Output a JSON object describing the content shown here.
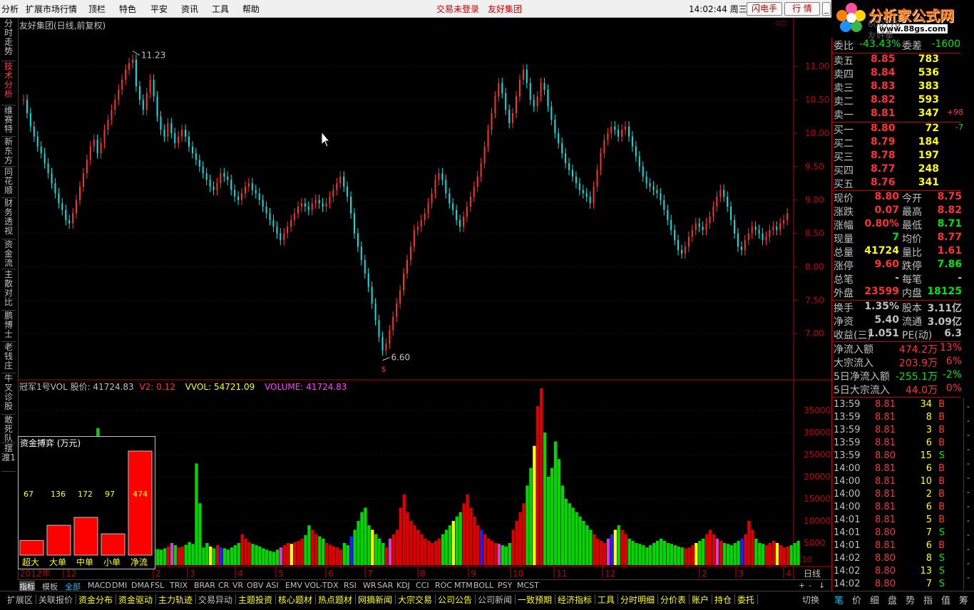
{
  "menu": [
    "分析",
    "扩展市场行情",
    "顶栏",
    "特色",
    "平安",
    "资讯",
    "工具",
    "帮助"
  ],
  "menu_alert": [
    "交易未登录",
    "友好集团"
  ],
  "clock": "14:02:44 周三",
  "menu_buttons": [
    "闪电手",
    "行 情"
  ],
  "logo": {
    "text": "分析家公式网",
    "url": "www.88gs.com"
  },
  "left_tabs": [
    "分时走势",
    "技术分析",
    "维赛特",
    "新东方",
    "同花顺",
    "财务透视",
    "资金流",
    "主散对比",
    "鹏博士",
    "老钱庄",
    "牛叉诊股",
    "敢死队",
    "摆渡1"
  ],
  "chart_title": "友好集团(日线,前复权)",
  "chart_code": "600778 友好集团",
  "price_axis": [
    "11.00",
    "10.50",
    "10.00",
    "9.50",
    "9.00",
    "8.50",
    "8.00",
    "7.50",
    "7.00"
  ],
  "annotations": {
    "high": "11.23",
    "low": "6.60",
    "low_mark": "$"
  },
  "indicator_header": {
    "name": "冠军1号VOL  股价: 41724.83",
    "v2": "V2: 0.12",
    "vvol": "VVOL: 54721.09",
    "volume": "VOLUME: 41724.83"
  },
  "volume_axis": [
    "35000",
    "30000",
    "25000",
    "20000",
    "15000",
    "10000",
    "5000"
  ],
  "volume_scale": "X10",
  "time_axis": [
    "2012年",
    "12",
    "2",
    "3",
    "4",
    "5",
    "6",
    "7",
    "8",
    "9",
    "10",
    "11",
    "12",
    "2",
    "3",
    "4"
  ],
  "period_label": "日线",
  "money_box": {
    "title": "资金搏弈 (万元)",
    "labels": [
      "超大",
      "大单",
      "中单",
      "小单",
      "净流"
    ],
    "values": [
      67,
      136,
      172,
      97,
      474
    ]
  },
  "indicator_tabs": [
    "指标",
    "模板",
    "全部",
    "MACD",
    "DMI",
    "DMA",
    "FSL",
    "TRIX",
    "BRAR",
    "CR",
    "VR",
    "OBV",
    "ASI",
    "EMV",
    "VOL-TDX",
    "RSI",
    "WR",
    "SAR",
    "KDJ",
    "CCI",
    "ROC",
    "MTM",
    "BOLL",
    "PSY",
    "MCST"
  ],
  "bottom_tabs": [
    "扩展区",
    "关联报价",
    "资金分布",
    "资金驱动",
    "主力轨迹",
    "交易异动",
    "主题投资",
    "核心题材",
    "热点题材",
    "网摘新闻",
    "大宗交易",
    "公司公告",
    "公司新闻",
    "一致预期",
    "经济指标",
    "工具",
    "分时明细",
    "分价表",
    "账户",
    "持仓",
    "委托"
  ],
  "bottom_tail": "切换",
  "right_tabs": [
    "笔",
    "价",
    "细",
    "盘",
    "势",
    "指",
    "值",
    "筹"
  ],
  "quote": {
    "weibi": {
      "label": "委比",
      "value": "-43.43%",
      "diff_label": "委差",
      "diff": "-1600"
    },
    "asks": [
      {
        "label": "卖五",
        "price": "8.85",
        "vol": "783",
        "chg": ""
      },
      {
        "label": "卖四",
        "price": "8.84",
        "vol": "536",
        "chg": ""
      },
      {
        "label": "卖三",
        "price": "8.83",
        "vol": "383",
        "chg": ""
      },
      {
        "label": "卖二",
        "price": "8.82",
        "vol": "593",
        "chg": ""
      },
      {
        "label": "卖一",
        "price": "8.81",
        "vol": "347",
        "chg": "+98"
      }
    ],
    "bids": [
      {
        "label": "买一",
        "price": "8.80",
        "vol": "72",
        "chg": "-7"
      },
      {
        "label": "买二",
        "price": "8.79",
        "vol": "184",
        "chg": ""
      },
      {
        "label": "买三",
        "price": "8.78",
        "vol": "197",
        "chg": ""
      },
      {
        "label": "买四",
        "price": "8.77",
        "vol": "248",
        "chg": ""
      },
      {
        "label": "买五",
        "price": "8.76",
        "vol": "341",
        "chg": ""
      }
    ],
    "stats": [
      {
        "l1": "现价",
        "v1": "8.80",
        "c1": "r",
        "l2": "今开",
        "v2": "8.75",
        "c2": "r"
      },
      {
        "l1": "涨跌",
        "v1": "0.07",
        "c1": "r",
        "l2": "最高",
        "v2": "8.82",
        "c2": "r"
      },
      {
        "l1": "涨幅",
        "v1": "0.80%",
        "c1": "r",
        "l2": "最低",
        "v2": "8.71",
        "c2": "g"
      },
      {
        "l1": "现量",
        "v1": "7",
        "c1": "g",
        "l2": "均价",
        "v2": "8.77",
        "c2": "r"
      },
      {
        "l1": "总量",
        "v1": "41724",
        "c1": "y",
        "l2": "量比",
        "v2": "1.61",
        "c2": "r"
      },
      {
        "l1": "涨停",
        "v1": "9.60",
        "c1": "r",
        "l2": "跌停",
        "v2": "7.86",
        "c2": "g"
      },
      {
        "l1": "总笔",
        "v1": "-",
        "c1": "w",
        "l2": "每笔",
        "v2": "-",
        "c2": "w"
      },
      {
        "l1": "外盘",
        "v1": "23599",
        "c1": "r",
        "l2": "内盘",
        "v2": "18125",
        "c2": "g"
      }
    ],
    "stats2": [
      {
        "l1": "换手",
        "v1": "1.35%",
        "c1": "w",
        "l2": "股本",
        "v2": "3.11亿",
        "c2": "w"
      },
      {
        "l1": "净资",
        "v1": "5.40",
        "c1": "w",
        "l2": "流通",
        "v2": "3.09亿",
        "c2": "w"
      },
      {
        "l1": "收益(三)",
        "v1": "1.051",
        "c1": "w",
        "l2": "PE(动)",
        "v2": "6.3",
        "c2": "w"
      }
    ],
    "flows": [
      {
        "label": "净流入额",
        "value": "474.2万",
        "pct": "13%",
        "c": "r"
      },
      {
        "label": "大宗流入",
        "value": "203.9万",
        "pct": "6%",
        "c": "r"
      },
      {
        "label": "5日净流入额",
        "value": "-255.1万",
        "pct": "-2%",
        "c": "g"
      },
      {
        "label": "5日大宗流入",
        "value": "44.0万",
        "pct": "0%",
        "c": "r"
      }
    ],
    "ticks": [
      {
        "t": "13:59",
        "p": "8.81",
        "v": "34",
        "d": "B"
      },
      {
        "t": "13:59",
        "p": "8.81",
        "v": "8",
        "d": "B"
      },
      {
        "t": "13:59",
        "p": "8.81",
        "v": "3",
        "d": "B"
      },
      {
        "t": "13:59",
        "p": "8.81",
        "v": "6",
        "d": "B"
      },
      {
        "t": "13:59",
        "p": "8.80",
        "v": "15",
        "d": "S"
      },
      {
        "t": "14:00",
        "p": "8.81",
        "v": "6",
        "d": "B"
      },
      {
        "t": "14:00",
        "p": "8.81",
        "v": "10",
        "d": "B"
      },
      {
        "t": "14:00",
        "p": "8.81",
        "v": "2",
        "d": "B"
      },
      {
        "t": "14:00",
        "p": "8.81",
        "v": "6",
        "d": "B"
      },
      {
        "t": "14:01",
        "p": "8.81",
        "v": "5",
        "d": "B"
      },
      {
        "t": "14:01",
        "p": "8.80",
        "v": "7",
        "d": "S"
      },
      {
        "t": "14:01",
        "p": "8.81",
        "v": "6",
        "d": "B"
      },
      {
        "t": "14:02",
        "p": "8.80",
        "v": "8",
        "d": "S"
      },
      {
        "t": "14:02",
        "p": "8.80",
        "v": "13",
        "d": "S"
      },
      {
        "t": "14:02",
        "p": "8.80",
        "v": "7",
        "d": "S"
      }
    ]
  },
  "colors": {
    "up": "#ff3232",
    "down": "#00e6e6",
    "vol_up": "#e00000",
    "vol_down": "#00d800",
    "accent": "#c00000",
    "text": "#c0c0c0"
  },
  "chart_data": {
    "type": "line",
    "close": [
      10.5,
      10.3,
      10.1,
      9.95,
      9.8,
      9.7,
      9.55,
      9.4,
      9.25,
      9.1,
      8.95,
      8.85,
      8.7,
      8.65,
      8.8,
      9.0,
      9.2,
      9.4,
      9.6,
      9.8,
      9.9,
      9.7,
      9.85,
      10.05,
      10.2,
      10.35,
      10.5,
      10.65,
      10.8,
      10.95,
      11.05,
      11.1,
      10.7,
      10.5,
      10.35,
      10.6,
      10.8,
      10.55,
      10.25,
      10.05,
      9.95,
      10.15,
      10.0,
      9.85,
      9.95,
      10.05,
      9.95,
      9.8,
      9.7,
      9.6,
      9.5,
      9.4,
      9.3,
      9.2,
      9.15,
      9.25,
      9.4,
      9.35,
      9.3,
      9.15,
      9.05,
      9.0,
      9.1,
      9.2,
      9.25,
      9.15,
      9.1,
      9.0,
      8.9,
      8.8,
      8.7,
      8.6,
      8.5,
      8.4,
      8.5,
      8.6,
      8.7,
      8.8,
      8.9,
      8.95,
      8.9,
      8.85,
      8.95,
      9.0,
      8.95,
      8.9,
      8.95,
      9.05,
      9.15,
      9.25,
      9.35,
      9.2,
      9.05,
      8.8,
      8.5,
      8.3,
      8.1,
      7.9,
      7.7,
      7.45,
      7.2,
      6.95,
      6.75,
      6.85,
      7.05,
      7.25,
      7.45,
      7.65,
      7.9,
      8.1,
      8.3,
      8.55,
      8.6,
      8.7,
      8.8,
      8.95,
      9.1,
      9.3,
      9.4,
      9.3,
      9.1,
      8.95,
      8.85,
      8.7,
      8.6,
      8.75,
      8.9,
      9.05,
      9.2,
      9.35,
      9.55,
      9.8,
      10.05,
      10.3,
      10.55,
      10.75,
      10.6,
      10.35,
      10.15,
      10.3,
      10.55,
      10.8,
      10.95,
      10.75,
      10.5,
      10.4,
      10.55,
      10.75,
      10.65,
      10.4,
      10.2,
      10.0,
      9.85,
      9.7,
      9.55,
      9.45,
      9.35,
      9.25,
      9.15,
      9.1,
      9.05,
      8.95,
      9.2,
      9.45,
      9.7,
      9.9,
      10.0,
      10.1,
      10.05,
      9.95,
      10.05,
      10.1,
      9.95,
      9.8,
      9.65,
      9.5,
      9.35,
      9.25,
      9.2,
      9.15,
      9.1,
      9.0,
      8.85,
      8.7,
      8.55,
      8.4,
      8.25,
      8.2,
      8.3,
      8.45,
      8.55,
      8.65,
      8.6,
      8.55,
      8.65,
      8.75,
      8.9,
      9.05,
      9.15,
      9.05,
      8.9,
      8.7,
      8.5,
      8.3,
      8.25,
      8.4,
      8.5,
      8.6,
      8.55,
      8.5,
      8.4,
      8.45,
      8.55,
      8.6,
      8.55,
      8.65,
      8.7,
      8.8
    ],
    "volume": [
      6000,
      5000,
      4500,
      4200,
      4000,
      3800,
      4500,
      5200,
      4800,
      4000,
      3500,
      3200,
      3000,
      3500,
      4200,
      5500,
      6000,
      5500,
      6500,
      7500,
      8000,
      31000,
      7000,
      7500,
      6500,
      7000,
      8000,
      9000,
      6000,
      5500,
      5000,
      4800,
      4500,
      5000,
      4500,
      4200,
      4000,
      3800,
      3600,
      3500,
      3800,
      4200,
      5000,
      4500,
      4000,
      4200,
      4600,
      5200,
      4800,
      23000,
      14000,
      4000,
      5000,
      4200,
      3800,
      4500,
      4000,
      3800,
      3500,
      4000,
      4500,
      5000,
      7000,
      6000,
      5200,
      4800,
      4500,
      4200,
      3800,
      3500,
      3200,
      3000,
      3500,
      4000,
      4500,
      5000,
      4800,
      5200,
      5500,
      6000,
      6800,
      9000,
      8000,
      7000,
      6500,
      6000,
      5000,
      4600,
      4200,
      4000,
      3500,
      5000,
      4500,
      6500,
      8000,
      10000,
      12000,
      13000,
      9000,
      8000,
      7000,
      6000,
      5000,
      4000,
      6000,
      7000,
      8000,
      13000,
      16000,
      12000,
      10000,
      9000,
      8000,
      7000,
      6000,
      5500,
      5000,
      5500,
      6000,
      7000,
      8000,
      9000,
      10000,
      11000,
      12000,
      14000,
      16000,
      13000,
      11000,
      9000,
      8000,
      7000,
      6000,
      5500,
      5000,
      4800,
      4500,
      4200,
      5000,
      8000,
      10000,
      12000,
      14000,
      18000,
      22000,
      27000,
      36000,
      40000,
      30000,
      20000,
      22000,
      28000,
      24000,
      18000,
      15000,
      14000,
      13000,
      12000,
      11000,
      10000,
      9000,
      8000,
      7000,
      6000,
      5500,
      5000,
      6000,
      7000,
      8000,
      9000,
      8000,
      7000,
      6000,
      5500,
      5000,
      4800,
      4500,
      4000,
      4500,
      5000,
      5500,
      6000,
      5500,
      5000,
      4800,
      4500,
      4200,
      4000,
      3800,
      4000,
      4500,
      5000,
      5500,
      6000,
      7000,
      8000,
      7000,
      6000,
      5500,
      5000,
      4800,
      4500,
      5000,
      5500,
      6000,
      7000,
      10000,
      8000,
      6000,
      5000,
      4800,
      4500,
      5000,
      5500,
      5000,
      4500,
      4000,
      4200,
      4500,
      5000,
      5500
    ],
    "price_range": [
      6.6,
      11.23
    ],
    "volume_range": [
      0,
      40000
    ]
  }
}
